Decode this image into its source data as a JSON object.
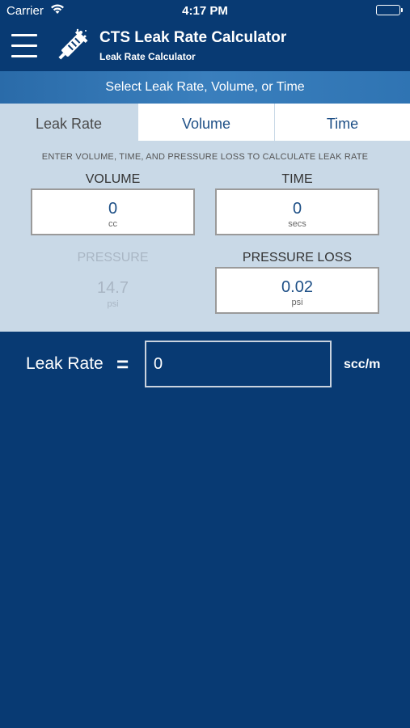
{
  "status": {
    "carrier": "Carrier",
    "time": "4:17 PM"
  },
  "header": {
    "title": "CTS Leak Rate Calculator",
    "subtitle": "Leak Rate Calculator"
  },
  "banner": {
    "text": "Select Leak Rate, Volume, or Time"
  },
  "tabs": [
    {
      "label": "Leak Rate",
      "active": true
    },
    {
      "label": "Volume",
      "active": false
    },
    {
      "label": "Time",
      "active": false
    }
  ],
  "instruction": "ENTER VOLUME, TIME, AND PRESSURE LOSS TO CALCULATE LEAK RATE",
  "fields": {
    "volume": {
      "label": "VOLUME",
      "value": "0",
      "unit": "cc"
    },
    "time": {
      "label": "TIME",
      "value": "0",
      "unit": "secs"
    },
    "pressure": {
      "label": "PRESSURE",
      "value": "14.7",
      "unit": "psi"
    },
    "pressure_loss": {
      "label": "PRESSURE LOSS",
      "value": "0.02",
      "unit": "psi"
    }
  },
  "result": {
    "label": "Leak Rate",
    "equals": "=",
    "value": "0",
    "unit": "scc/m"
  },
  "colors": {
    "primary": "#083a73",
    "banner": "#3a7fbd",
    "panel": "#c9d9e7",
    "accent_text": "#1d4f86",
    "battery": "#4cd964"
  }
}
